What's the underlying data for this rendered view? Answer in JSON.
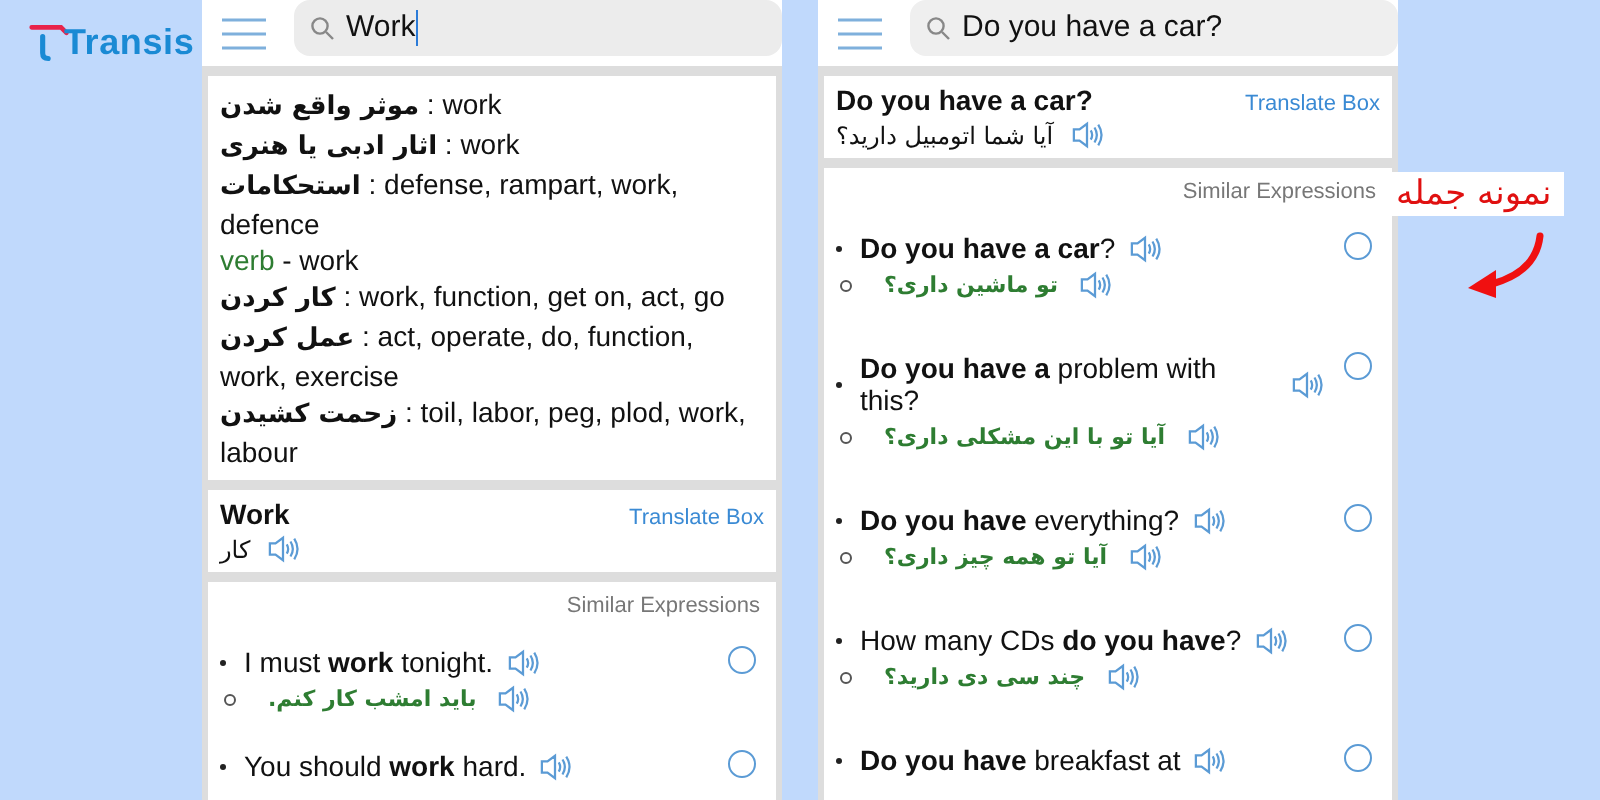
{
  "logo": {
    "text": "Transis"
  },
  "panels": [
    {
      "search": {
        "value": "Work",
        "focused": true
      },
      "definitions": [
        {
          "kind": "entry",
          "term": "موثر واقع شدن",
          "meaning": ": work"
        },
        {
          "kind": "entry",
          "term": "اثار ادبی یا هنری",
          "meaning": ": work"
        },
        {
          "kind": "entry",
          "term": "استحکامات",
          "meaning": ": defense, rampart, work, defence"
        },
        {
          "kind": "pos",
          "pos": "verb",
          "meaning": "- work"
        },
        {
          "kind": "entry",
          "term": "کار کردن",
          "meaning": ": work, function, get on, act, go"
        },
        {
          "kind": "entry",
          "term": "عمل کردن",
          "meaning": ": act, operate, do, function, work, exercise"
        },
        {
          "kind": "entry",
          "term": "زحمت کشیدن",
          "meaning": ": toil, labor, peg, plod, work, labour"
        }
      ],
      "word_card": {
        "word": "Work",
        "translation": "کار",
        "link": "Translate Box"
      },
      "similar": {
        "title": "Similar Expressions",
        "items": [
          {
            "english": "I must **work** tonight.",
            "persian": "باید امشب کار کنم.",
            "selected": false
          },
          {
            "english": "You should **work** hard.",
            "selected": false
          }
        ]
      }
    },
    {
      "search": {
        "value": "Do you have a car?",
        "focused": false
      },
      "word_card": {
        "word": "Do you have a car?",
        "translation": "آیا شما اتومبیل دارید؟",
        "link": "Translate Box"
      },
      "similar": {
        "title": "Similar Expressions",
        "items": [
          {
            "english": "**Do you have a car**?",
            "persian": "تو ماشین داری؟",
            "selected": false
          },
          {
            "english": "**Do you have a** problem with this?",
            "persian": "آیا تو با این مشکلی داری؟",
            "selected": false
          },
          {
            "english": "**Do you have** everything?",
            "persian": "آیا تو همه چیز داری؟",
            "selected": false
          },
          {
            "english": "How many CDs **do you have**?",
            "persian": "چند سی دی دارید؟",
            "selected": false
          },
          {
            "english": "**Do you have** breakfast at",
            "selected": false
          }
        ]
      }
    }
  ],
  "annotation": {
    "label": "نمونه جمله"
  }
}
